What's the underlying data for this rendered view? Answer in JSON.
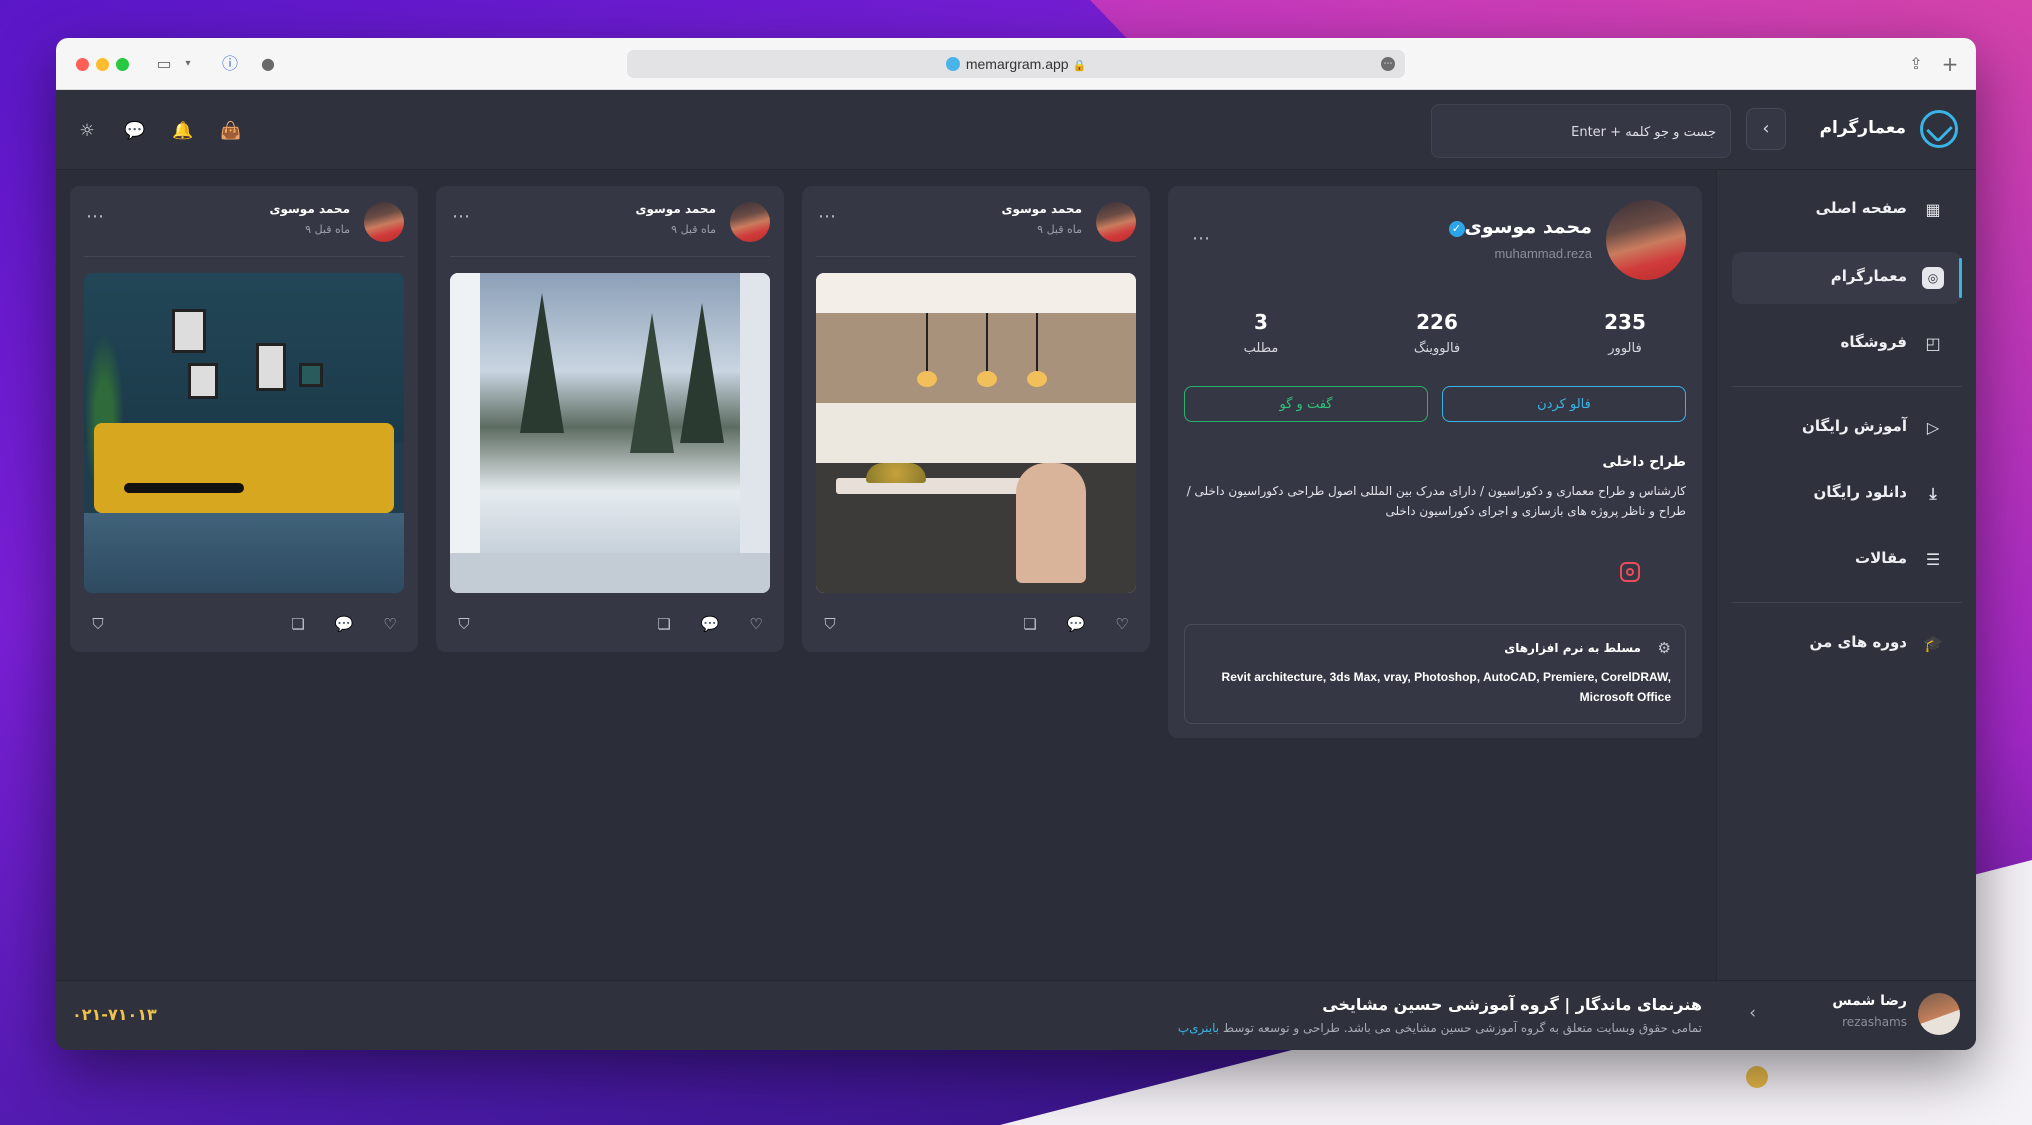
{
  "browser": {
    "url": "memargram.app"
  },
  "header": {
    "brand": "معمارگرام",
    "collapse_icon": "chevron-left-icon",
    "search_placeholder": "جست و جو کلمه + Enter",
    "icons": [
      "sun-icon",
      "chat-icon",
      "bell-icon",
      "shopping-bag-icon"
    ]
  },
  "sidebar": {
    "items": [
      {
        "label": "صفحه اصلی",
        "icon": "grid-icon",
        "active": false
      },
      {
        "label": "معمارگرام",
        "icon": "memargram-icon",
        "active": true
      },
      {
        "label": "فروشگاه",
        "icon": "shopping-bag-icon",
        "active": false
      },
      {
        "label": "آموزش رایگان",
        "icon": "play-icon",
        "active": false
      },
      {
        "label": "دانلود رایگان",
        "icon": "download-icon",
        "active": false
      },
      {
        "label": "مقالات",
        "icon": "document-icon",
        "active": false
      },
      {
        "label": "دوره های من",
        "icon": "graduation-cap-icon",
        "active": false
      }
    ]
  },
  "profile": {
    "name": "محمد موسوی",
    "username": "muhammad.reza",
    "stats": [
      {
        "value": "235",
        "label": "فالوور"
      },
      {
        "value": "226",
        "label": "فالووینگ"
      },
      {
        "value": "3",
        "label": "مطلب"
      }
    ],
    "follow_label": "فالو کردن",
    "chat_label": "گفت و گو",
    "bio_title": "طراح داخلی",
    "bio_text": "کارشناس و طراح معماری و دکوراسیون / دارای مدرک بین المللی اصول طراحی دکوراسیون داخلی / طراح و ناظر پروژه های بازسازی و اجرای دکوراسیون داخلی",
    "skills_title": "مسلط به نرم افزارهای",
    "skills_text": "Revit architecture, 3ds Max, vray, Photoshop, AutoCAD, Premiere, CorelDRAW, Microsoft Office"
  },
  "posts": [
    {
      "author": "محمد موسوی",
      "time": "۹ ماه قبل",
      "image": "kitchen"
    },
    {
      "author": "محمد موسوی",
      "time": "۹ ماه قبل",
      "image": "winter-window"
    },
    {
      "author": "محمد موسوی",
      "time": "۹ ماه قبل",
      "image": "living-room"
    }
  ],
  "footer": {
    "user_name": "رضا شمس",
    "user_handle": "rezashams",
    "title": "هنرنمای ماندگار | گروه آموزشی حسین مشایخی",
    "subtitle": "تمامی حقوق وبسایت متعلق به گروه آموزشی حسین مشایخی می باشد. طراحی و توسعه توسط",
    "subtitle_link": "باینری‌پ",
    "phone": "۰۲۱-۷۱۰۱۳"
  },
  "colors": {
    "accent": "#3ab4e6",
    "chat_green": "#2fc27a",
    "phone_yellow": "#f0c34d",
    "panel": "#353844",
    "background": "#2b2e38"
  }
}
